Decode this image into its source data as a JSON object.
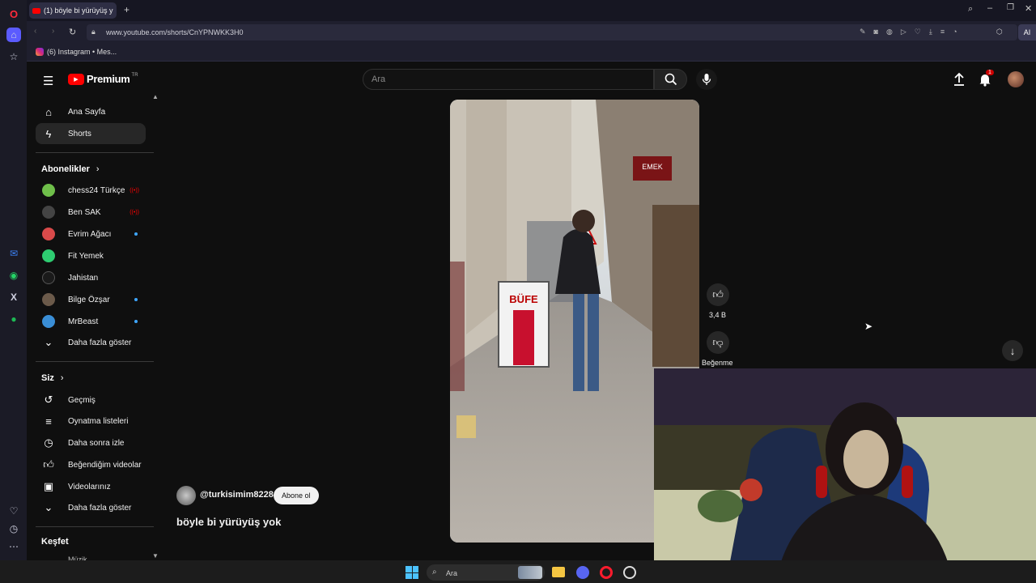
{
  "browser": {
    "tab_title": "(1) böyle bi yürüyüş y",
    "url": "www.youtube.com/shorts/CnYPNWKK3H0",
    "bookmark": "(6) Instagram • Mes...",
    "new_tab_label": "+",
    "ext_label": "AI"
  },
  "youtube": {
    "logo_text": "Premium",
    "logo_badge": "TR",
    "search_placeholder": "Ara",
    "notification_count": "1",
    "guide": {
      "top": [
        {
          "label": "Ana Sayfa",
          "icon": "home-icon"
        },
        {
          "label": "Shorts",
          "icon": "shorts-icon"
        }
      ],
      "subscriptions_title": "Abonelikler",
      "subscriptions": [
        {
          "label": "chess24 Türkçe",
          "color": "#6fbf4a",
          "status": "live"
        },
        {
          "label": "Ben SAK",
          "color": "#444444",
          "status": "live"
        },
        {
          "label": "Evrim Ağacı",
          "color": "#d94a4a",
          "status": "dot"
        },
        {
          "label": "Fit Yemek",
          "color": "#2ecc71",
          "status": ""
        },
        {
          "label": "Jahistan",
          "color": "#1a1a1a",
          "status": ""
        },
        {
          "label": "Bilge Özşar",
          "color": "#6b5a4a",
          "status": "dot"
        },
        {
          "label": "MrBeast",
          "color": "#3a8ed6",
          "status": "dot"
        }
      ],
      "subs_more": "Daha fazla göster",
      "you_title": "Siz",
      "you": [
        {
          "label": "Geçmiş",
          "icon": "history-icon"
        },
        {
          "label": "Oynatma listeleri",
          "icon": "playlist-icon"
        },
        {
          "label": "Daha sonra izle",
          "icon": "clock-icon"
        },
        {
          "label": "Beğendiğim videolar",
          "icon": "like-icon"
        },
        {
          "label": "Videolarınız",
          "icon": "video-icon"
        }
      ],
      "you_more": "Daha fazla göster",
      "explore_title": "Keşfet",
      "explore_first": "Müzik"
    },
    "short": {
      "channel": "@turkisimim8228",
      "subscribe": "Abone ol",
      "title": "böyle bi yürüyüş yok",
      "likes": "3,4 B",
      "dislike": "Beğenme",
      "sign_text": "BÜFE",
      "shop_sign": "EMEK"
    }
  },
  "taskbar": {
    "search_label": "Ara"
  },
  "colors": {
    "yt_red": "#ff0000",
    "bg": "#0f0f0f",
    "active_item": "#272727"
  }
}
